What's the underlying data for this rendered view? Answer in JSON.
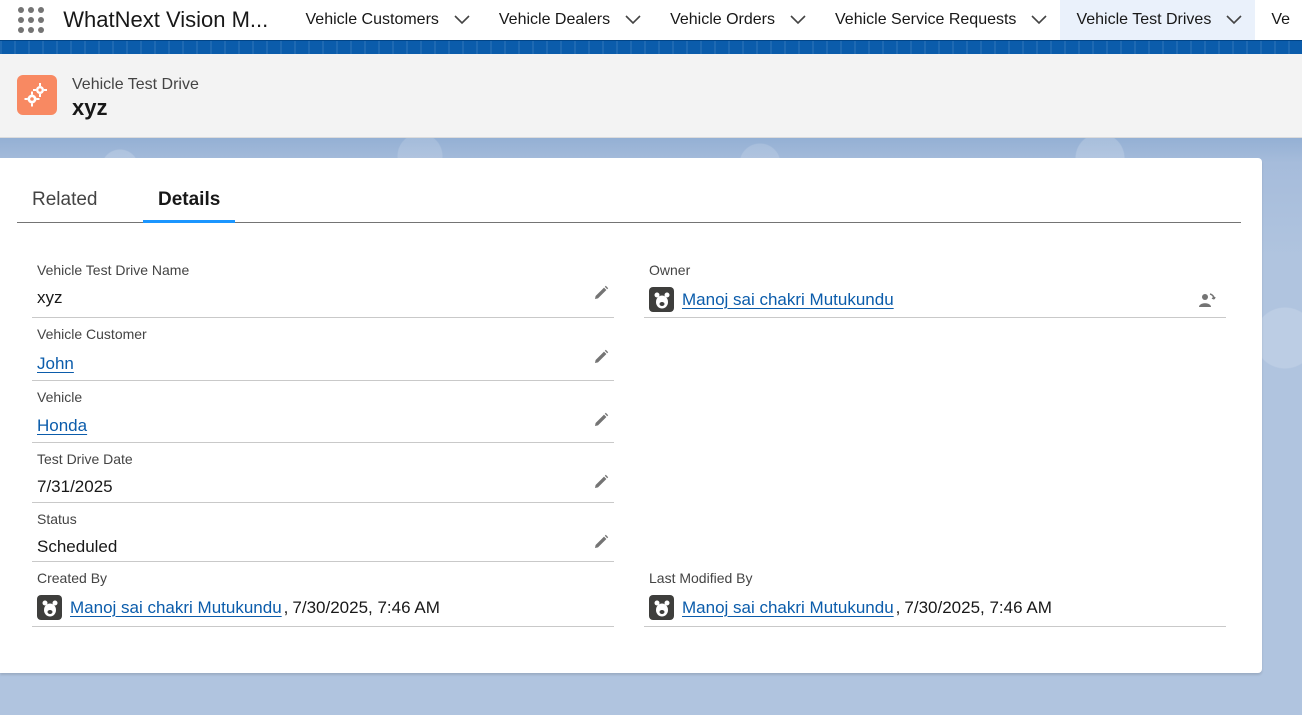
{
  "app": {
    "name": "WhatNext Vision M..."
  },
  "nav": {
    "tabs": [
      {
        "label": "Vehicle Customers"
      },
      {
        "label": "Vehicle Dealers"
      },
      {
        "label": "Vehicle Orders"
      },
      {
        "label": "Vehicle Service Requests"
      },
      {
        "label": "Vehicle Test Drives",
        "active": true
      },
      {
        "label": "Ve"
      }
    ]
  },
  "record": {
    "object_label": "Vehicle Test Drive",
    "name": "xyz",
    "icon": "gears-icon",
    "icon_color": "#f88962"
  },
  "card_tabs": [
    {
      "label": "Related"
    },
    {
      "label": "Details",
      "active": true
    }
  ],
  "fields": {
    "name": {
      "label": "Vehicle Test Drive Name",
      "value": "xyz"
    },
    "customer": {
      "label": "Vehicle Customer",
      "value": "John"
    },
    "vehicle": {
      "label": "Vehicle",
      "value": "Honda"
    },
    "date": {
      "label": "Test Drive Date",
      "value": "7/31/2025"
    },
    "status": {
      "label": "Status",
      "value": "Scheduled"
    },
    "owner": {
      "label": "Owner",
      "value": "Manoj sai chakri Mutukundu"
    },
    "created_by": {
      "label": "Created By",
      "user": "Manoj sai chakri Mutukundu",
      "datetime": "7/30/2025, 7:46 AM"
    },
    "modified_by": {
      "label": "Last Modified By",
      "user": "Manoj sai chakri Mutukundu",
      "datetime": "7/30/2025, 7:46 AM"
    }
  },
  "colors": {
    "link": "#0b5cab",
    "accent": "#1b96ff",
    "nav_bar": "#0b5cab"
  }
}
